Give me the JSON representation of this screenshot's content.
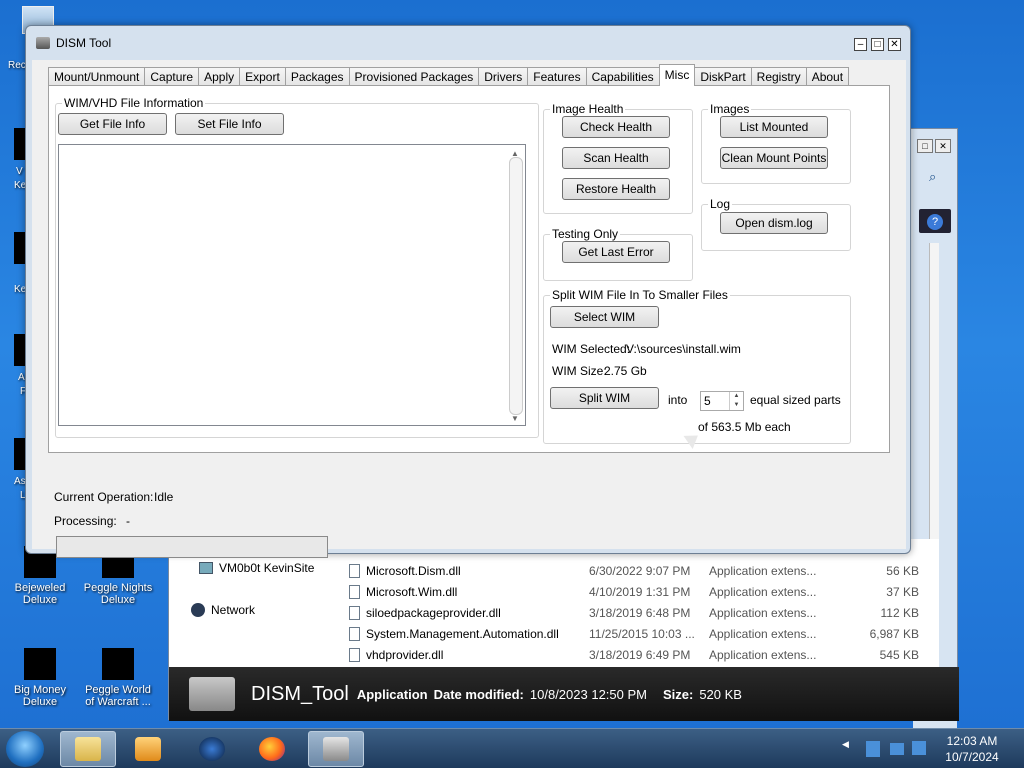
{
  "desktop": {
    "partial_labels": [
      "Rec",
      "V",
      "Ke",
      "Ke",
      "A",
      "F",
      "As",
      "L"
    ],
    "icons": [
      {
        "line1": "Bejeweled",
        "line2": "Deluxe"
      },
      {
        "line1": "Peggle Nights",
        "line2": "Deluxe"
      },
      {
        "line1": "Big Money",
        "line2": "Deluxe"
      },
      {
        "line1": "Peggle World",
        "line2": "of Warcraft ..."
      }
    ]
  },
  "explorer": {
    "nav": {
      "computer": "VM0b0t KevinSite",
      "network": "Network"
    },
    "files": [
      {
        "name": "Microsoft.Dism.dll",
        "date": "6/30/2022 9:07 PM",
        "type": "Application extens...",
        "size": "56 KB"
      },
      {
        "name": "Microsoft.Wim.dll",
        "date": "4/10/2019 1:31 PM",
        "type": "Application extens...",
        "size": "37 KB"
      },
      {
        "name": "siloedpackageprovider.dll",
        "date": "3/18/2019 6:48 PM",
        "type": "Application extens...",
        "size": "112 KB"
      },
      {
        "name": "System.Management.Automation.dll",
        "date": "11/25/2015 10:03 ...",
        "type": "Application extens...",
        "size": "6,987 KB"
      },
      {
        "name": "vhdprovider.dll",
        "date": "3/18/2019 6:49 PM",
        "type": "Application extens...",
        "size": "545 KB"
      }
    ],
    "details": {
      "name": "DISM_Tool",
      "type": "Application",
      "modified_label": "Date modified:",
      "modified_value": "10/8/2023 12:50 PM",
      "size_label": "Size:",
      "size_value": "520 KB"
    }
  },
  "window": {
    "title": "DISM Tool",
    "controls": {
      "minimize": "–",
      "maximize": "□",
      "close": "✕"
    }
  },
  "tabs": [
    "Mount/Unmount",
    "Capture",
    "Apply",
    "Export",
    "Packages",
    "Provisioned Packages",
    "Drivers",
    "Features",
    "Capabilities",
    "Misc",
    "DiskPart",
    "Registry",
    "About"
  ],
  "active_tab": "Misc",
  "file_info": {
    "group_title": "WIM/VHD File Information",
    "get_button": "Get File Info",
    "set_button": "Set File Info"
  },
  "image_health": {
    "group_title": "Image Health",
    "check": "Check Health",
    "scan": "Scan Health",
    "restore": "Restore Health"
  },
  "images": {
    "group_title": "Images",
    "list_mounted": "List Mounted",
    "clean_mount_points": "Clean Mount Points"
  },
  "log": {
    "group_title": "Log",
    "open_log": "Open dism.log"
  },
  "testing": {
    "group_title": "Testing Only",
    "get_last_error": "Get Last Error"
  },
  "split": {
    "group_title": "Split WIM File In To Smaller Files",
    "select_wim": "Select WIM",
    "wim_selected_label": "WIM Selected:",
    "wim_selected_value": "V:\\sources\\install.wim",
    "wim_size_label": "WIM Size:",
    "wim_size_value": "2.75 Gb",
    "split_button": "Split WIM",
    "into_label": "into",
    "parts": "5",
    "parts_suffix": "equal sized parts",
    "each_text": "of 563.5 Mb each"
  },
  "status": {
    "current_operation_label": "Current Operation:",
    "current_operation_value": "Idle",
    "processing_label": "Processing:",
    "processing_value": "-",
    "progress_fraction": 0
  },
  "clock": {
    "time": "12:03 AM",
    "date": "10/7/2024"
  },
  "colors": {
    "desktop": "#1f72d6",
    "taskbar": "#2b4a6e",
    "window_frame": "#d5e1ee"
  }
}
